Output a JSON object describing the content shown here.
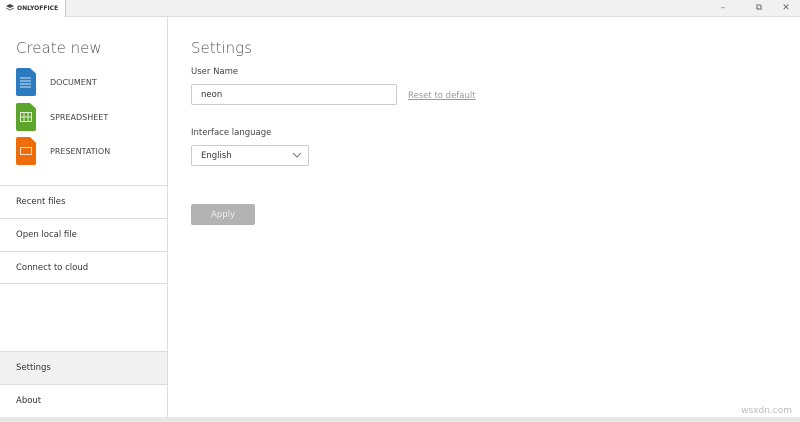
{
  "app": {
    "name": "ONLYOFFICE",
    "window_controls": [
      "minimize",
      "restore",
      "close"
    ]
  },
  "sidebar": {
    "create_title": "Create new",
    "create_items": [
      {
        "label": "DOCUMENT",
        "color": "#2a7bbf"
      },
      {
        "label": "SPREADSHEET",
        "color": "#5aa52a"
      },
      {
        "label": "PRESENTATION",
        "color": "#ef6c0b"
      }
    ],
    "nav": [
      {
        "label": "Recent files"
      },
      {
        "label": "Open local file"
      },
      {
        "label": "Connect to cloud"
      },
      {
        "label": "Settings",
        "active": true
      },
      {
        "label": "About"
      }
    ]
  },
  "settings": {
    "title": "Settings",
    "user_name_label": "User Name",
    "user_name_value": "neon",
    "reset_label": "Reset to default",
    "language_label": "Interface language",
    "language_value": "English",
    "apply_label": "Apply"
  },
  "watermark": "wsxdn.com"
}
